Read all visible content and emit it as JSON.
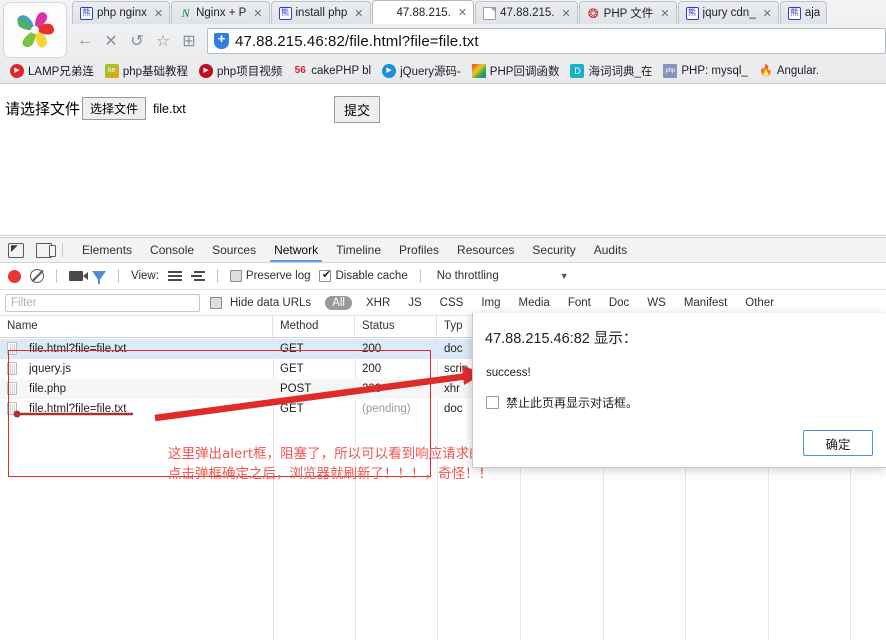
{
  "browser": {
    "logo_name": "360-browser-logo",
    "tabs": [
      {
        "label": "php nginx",
        "favicon": "baidu-icon",
        "active": false
      },
      {
        "label": "Nginx + P",
        "favicon": "nginx-icon",
        "active": false
      },
      {
        "label": "install php",
        "favicon": "baidu-icon",
        "active": false
      },
      {
        "label": "47.88.215.",
        "favicon": "blank-icon",
        "active": true
      },
      {
        "label": "47.88.215.",
        "favicon": "document-icon",
        "active": false
      },
      {
        "label": "PHP 文件",
        "favicon": "php-icon",
        "active": false
      },
      {
        "label": "jqury cdn_",
        "favicon": "baidu-icon",
        "active": false
      },
      {
        "label": "aja",
        "favicon": "baidu-icon",
        "active": false
      }
    ],
    "tab_close_glyph": "✕",
    "nav": {
      "back": "←",
      "stop": "✕",
      "reload": "↺",
      "bookmark": "☆",
      "apps": "⊞"
    },
    "url": "47.88.215.46:82/file.html?file=file.txt",
    "bookmarks": [
      {
        "label": "LAMP兄弟连",
        "icon": "play-red-icon"
      },
      {
        "label": "php基础教程",
        "icon": "kem-icon"
      },
      {
        "label": "php项目视频",
        "icon": "play-dark-icon"
      },
      {
        "label": "cakePHP bl",
        "icon": "56-icon"
      },
      {
        "label": "jQuery源码-",
        "icon": "jquery-icon"
      },
      {
        "label": "PHP回调函数",
        "icon": "mosaic-icon"
      },
      {
        "label": "海词词典_在",
        "icon": "d-icon"
      },
      {
        "label": "PHP: mysql_",
        "icon": "php-text-icon"
      },
      {
        "label": "Angular.",
        "icon": "fire-icon"
      }
    ]
  },
  "page": {
    "label": "请选择文件",
    "choose_file_button": "选择文件",
    "file_name": "file.txt",
    "submit_button": "提交"
  },
  "devtools": {
    "icons": {
      "inspect": "inspect-element-icon",
      "device": "device-toolbar-icon"
    },
    "panels": [
      {
        "label": "Elements",
        "selected": false
      },
      {
        "label": "Console",
        "selected": false
      },
      {
        "label": "Sources",
        "selected": false
      },
      {
        "label": "Network",
        "selected": true
      },
      {
        "label": "Timeline",
        "selected": false
      },
      {
        "label": "Profiles",
        "selected": false
      },
      {
        "label": "Resources",
        "selected": false
      },
      {
        "label": "Security",
        "selected": false
      },
      {
        "label": "Audits",
        "selected": false
      }
    ],
    "toolbar": {
      "record_icon": "record-icon",
      "clear_icon": "clear-icon",
      "capture_screenshots_icon": "camera-icon",
      "filter_icon": "funnel-icon",
      "view_label": "View:",
      "view_list_icon": "list-view-icon",
      "view_tree_icon": "tree-view-icon",
      "preserve_log_label": "Preserve log",
      "preserve_log_checked": false,
      "disable_cache_label": "Disable cache",
      "disable_cache_checked": true,
      "throttling": "No throttling",
      "caret_icon": "chevron-down-icon"
    },
    "filterbar": {
      "placeholder": "Filter",
      "value": "",
      "hide_data_urls_label": "Hide data URLs",
      "hide_data_urls_checked": false,
      "types": [
        "All",
        "XHR",
        "JS",
        "CSS",
        "Img",
        "Media",
        "Font",
        "Doc",
        "WS",
        "Manifest",
        "Other"
      ]
    },
    "table": {
      "columns": [
        "Name",
        "Method",
        "Status",
        "Typ"
      ],
      "rows": [
        {
          "name": "file.html?file=file.txt",
          "method": "GET",
          "status": "200",
          "type": "doc",
          "selected": true,
          "pending": false
        },
        {
          "name": "jquery.js",
          "method": "GET",
          "status": "200",
          "type": "scrip",
          "selected": false,
          "pending": false
        },
        {
          "name": "file.php",
          "method": "POST",
          "status": "200",
          "type": "xhr",
          "selected": false,
          "pending": false
        },
        {
          "name": "file.html?file=file.txt",
          "method": "GET",
          "status": "(pending)",
          "type": "doc",
          "selected": false,
          "pending": true
        }
      ]
    }
  },
  "alert": {
    "title": "47.88.215.46:82 显示：",
    "message": "success!",
    "suppress_label": "禁止此页再显示对话框。",
    "suppress_checked": false,
    "ok_button": "确定"
  },
  "annotation": {
    "line1": "这里弹出alert框，阻塞了，所以可以看到响应请求的file.php这个请求，",
    "line2": "点击弹框确定之后，浏览器就刷新了！！！，奇怪！！",
    "color": "#f0554f"
  }
}
